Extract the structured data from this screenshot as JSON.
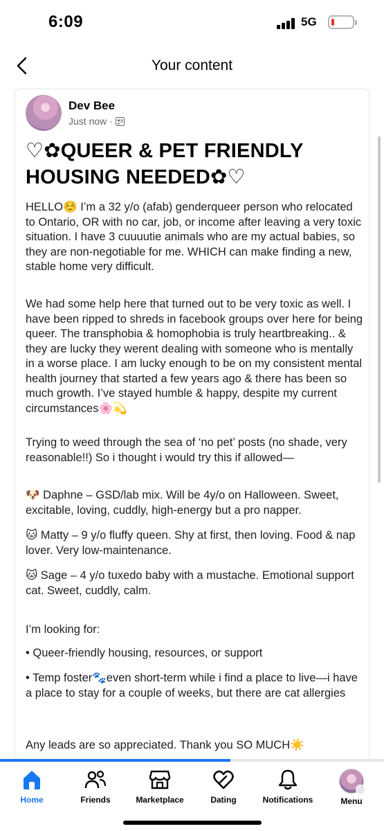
{
  "status": {
    "time": "6:09",
    "network": "5G",
    "battery_level": 0.15,
    "battery_color": "#e0362f"
  },
  "header": {
    "title": "Your content",
    "back_icon": "chevron-left-icon"
  },
  "post": {
    "author": "Dev Bee",
    "time": "Just now",
    "audience_icon": "friends-list-icon",
    "title": "♡✿QUEER & PET FRIENDLY HOUSING NEEDED✿♡",
    "paragraphs": [
      "HELLO☺️ I’m a 32 y/o (afab) genderqueer person who relocated to Ontario, OR with no car, job, or income after leaving a very toxic situation. I have 3 cuuuutie animals who are my actual babies, so they are non-negotiable for me. WHICH can make finding a new, stable home very difficult.",
      "We had some help here that turned out to be very toxic as well. I have been ripped to shreds in facebook groups over here for being queer. The transphobia & homophobia is truly heartbreaking.. & they are lucky they werent dealing with someone who is mentally in a worse place. I am lucky enough to be on my consistent mental health journey that started a few years ago & there has been so much growth. I’ve stayed humble & happy, despite my current circumstances🌸💫",
      "Trying to weed through the sea of ‘no pet’ posts (no shade, very reasonable!!) So i thought i would try this if allowed—",
      "🐶 Daphne – GSD/lab mix. Will be 4y/o on Halloween. Sweet, excitable, loving, cuddly, high-energy but a pro napper.",
      "🐱 Matty – 9 y/o fluffy queen. Shy at first, then loving. Food & nap lover. Very low-maintenance.",
      "🐱 Sage – 4 y/o tuxedo baby with a mustache. Emotional support cat. Sweet, cuddly, calm.",
      "I’m looking for:",
      " • Queer-friendly housing, resources, or support",
      " • Temp foster🐾even short-term while i find a place to live—i have a place to stay for a couple of weeks, but there are cat allergies",
      "Any leads are so appreciated. Thank you SO MUCH☀️"
    ]
  },
  "nav": {
    "progress": 0.6,
    "accent": "#1877f2",
    "items": [
      {
        "label": "Home",
        "icon": "home-icon"
      },
      {
        "label": "Friends",
        "icon": "friends-icon"
      },
      {
        "label": "Marketplace",
        "icon": "marketplace-icon"
      },
      {
        "label": "Dating",
        "icon": "dating-heart-icon"
      },
      {
        "label": "Notifications",
        "icon": "bell-icon"
      },
      {
        "label": "Menu",
        "icon": "profile-avatar"
      }
    ]
  }
}
